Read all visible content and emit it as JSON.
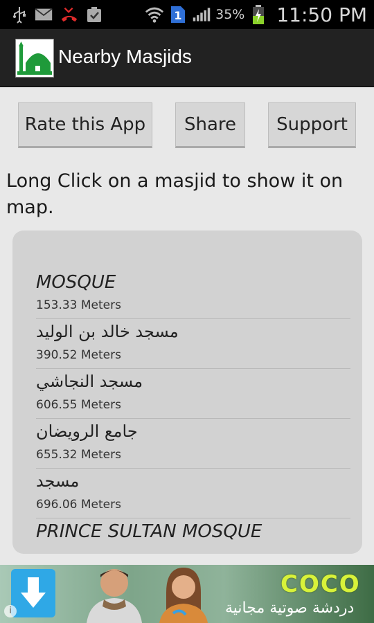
{
  "status_bar": {
    "battery_percent": "35%",
    "time": "11:50 PM",
    "sim_slot": "1",
    "icons": [
      "usb-icon",
      "email-icon",
      "missed-call-icon",
      "clipboard-icon",
      "wifi-icon",
      "sim-icon",
      "signal-icon",
      "battery-charging-icon"
    ]
  },
  "action_bar": {
    "title": "Nearby Masjids",
    "icon": "mosque-icon"
  },
  "buttons": {
    "rate": "Rate this App",
    "share": "Share",
    "support": "Support"
  },
  "hint": "Long Click on a masjid to show it on map.",
  "masjids": [
    {
      "name": "MOSQUE",
      "distance": "153.33 Meters"
    },
    {
      "name": "مسجد خالد بن الوليد",
      "distance": "390.52 Meters"
    },
    {
      "name": "مسجد النجاشي",
      "distance": "606.55 Meters"
    },
    {
      "name": "جامع الرويضان",
      "distance": "655.32 Meters"
    },
    {
      "name": "مسجد",
      "distance": "696.06 Meters"
    },
    {
      "name": "PRINCE SULTAN MOSQUE",
      "distance": ""
    }
  ],
  "ad": {
    "brand": "COCO",
    "tagline": "دردشة صوتية مجانية",
    "info": "i",
    "colors": {
      "brand": "#d8f23a",
      "download": "#2fa8e6"
    }
  }
}
